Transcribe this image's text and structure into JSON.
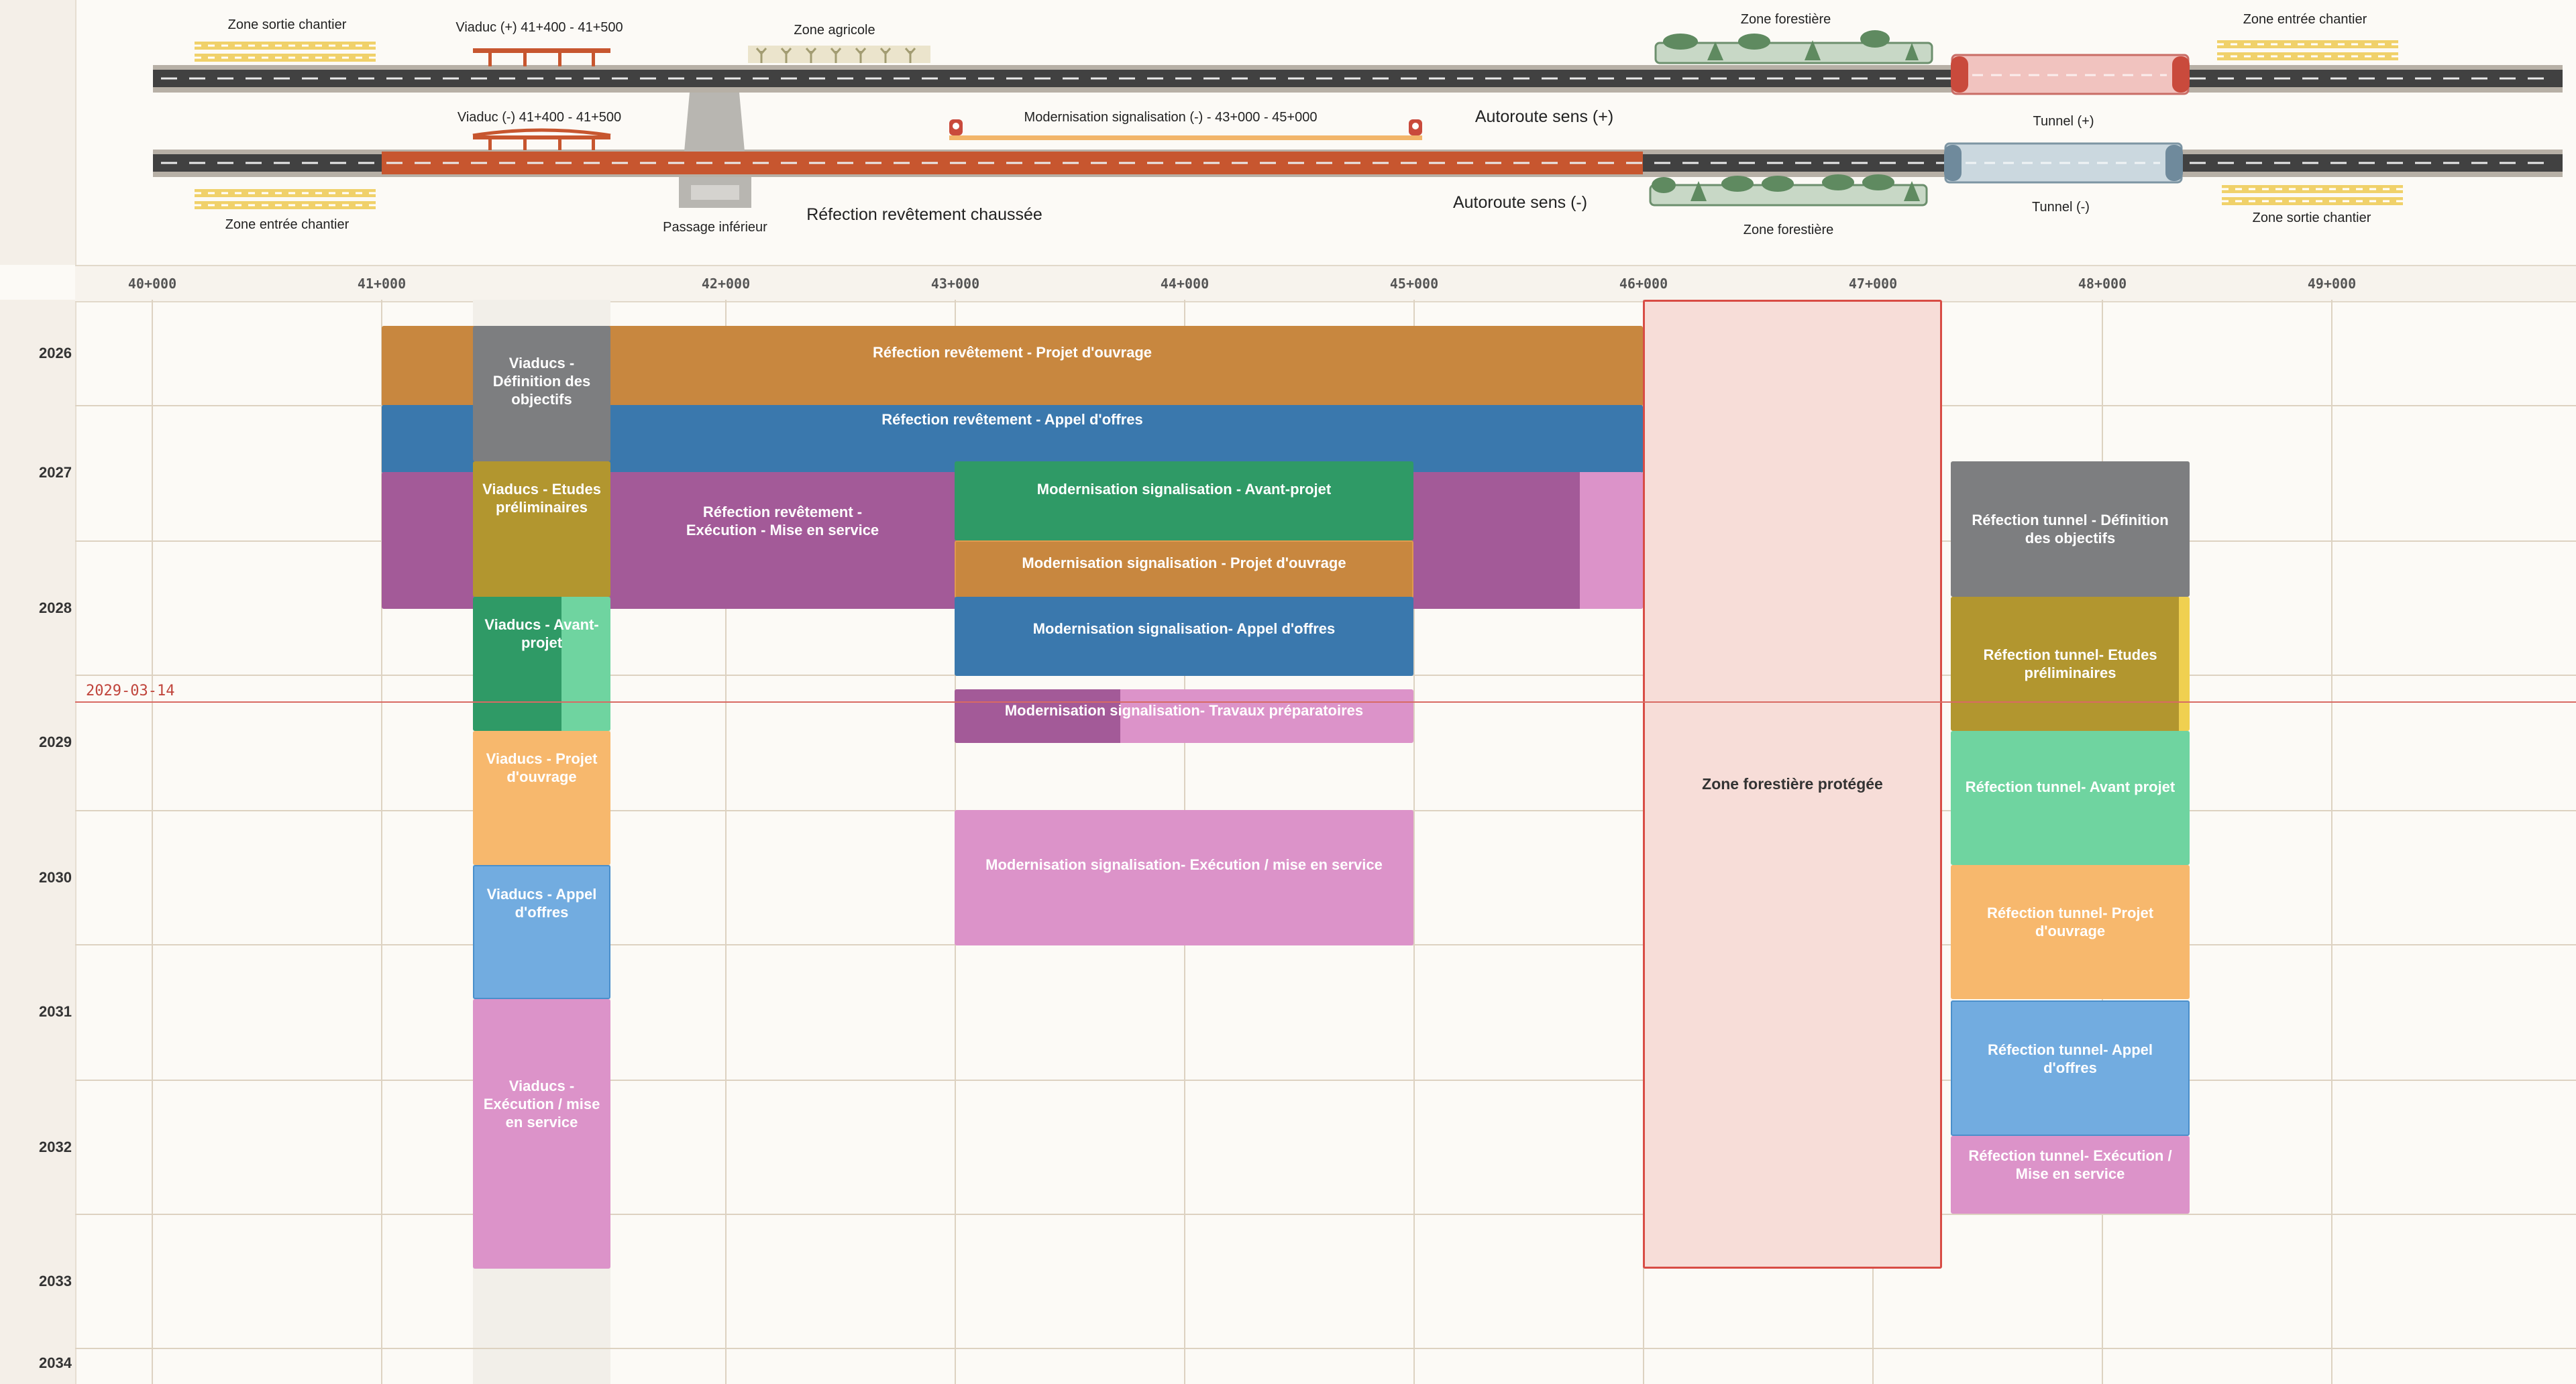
{
  "scene": {
    "zone_sortie_chantier_top": "Zone sortie chantier",
    "viaduc_plus": "Viaduc (+) 41+400 - 41+500",
    "zone_agricole": "Zone agricole",
    "zone_forestiere_top": "Zone forestière",
    "zone_entree_chantier_top": "Zone entrée chantier",
    "viaduc_minus": "Viaduc (-) 41+400 - 41+500",
    "modernisation_label": "Modernisation signalisation (-) - 43+000 - 45+000",
    "autoroute_plus": "Autoroute sens (+)",
    "tunnel_plus": "Tunnel (+)",
    "autoroute_minus": "Autoroute sens (-)",
    "tunnel_minus": "Tunnel (-)",
    "zone_entree_chantier_bottom": "Zone entrée chantier",
    "passage_inferieur": "Passage inférieur",
    "refection_chaussee": "Réfection revêtement chaussée",
    "zone_forestiere_bottom": "Zone forestière",
    "zone_sortie_chantier_bottom": "Zone sortie chantier"
  },
  "ruler": {
    "ticks": [
      "40+000",
      "41+000",
      "42+000",
      "43+000",
      "44+000",
      "45+000",
      "46+000",
      "47+000",
      "48+000",
      "49+000"
    ]
  },
  "years": [
    "2026",
    "2027",
    "2028",
    "2029",
    "2030",
    "2031",
    "2032",
    "2033",
    "2034"
  ],
  "today": "2029-03-14",
  "colors": {
    "orange": "#c8873f",
    "blue": "#3a78ad",
    "purple": "#a35a98",
    "pink": "#dc93c9",
    "gray": "#7d7e80",
    "olive": "#b2962f",
    "green": "#2f9a66",
    "light_green": "#6fd4a0",
    "light_orange": "#f7b86d",
    "light_blue": "#72ace0",
    "protected_fill": "#f7ddd8",
    "protected_border": "#d84c45"
  },
  "tasks": {
    "ref_projet": "Réfection revêtement - Projet d'ouvrage",
    "ref_appel": "Réfection revêtement - Appel d'offres",
    "ref_exec": "Réfection revêtement -\nExécution - Mise en service",
    "via_def": "Viaducs -\nDéfinition des\nobjectifs",
    "via_etudes": "Viaducs - Etudes\npréliminaires",
    "via_avant": "Viaducs - Avant-\nprojet",
    "via_projet": "Viaducs - Projet\nd'ouvrage",
    "via_appel": "Viaducs - Appel\nd'offres",
    "via_exec": "Viaducs -\nExécution / mise\nen service",
    "mod_avant": "Modernisation signalisation - Avant-projet",
    "mod_projet": "Modernisation signalisation - Projet d'ouvrage",
    "mod_appel": "Modernisation signalisation- Appel d'offres",
    "mod_travaux": "Modernisation signalisation- Travaux préparatoires",
    "mod_exec": "Modernisation signalisation- Exécution / mise en service",
    "zone_protegee": "Zone forestière protégée",
    "tun_def": "Réfection tunnel - Définition\ndes objectifs",
    "tun_etudes": "Réfection tunnel- Etudes\npréliminaires",
    "tun_avant": "Réfection tunnel- Avant projet",
    "tun_projet": "Réfection tunnel- Projet\nd'ouvrage",
    "tun_appel": "Réfection tunnel- Appel\nd'offres",
    "tun_exec": "Réfection tunnel- Exécution /\nMise en service"
  }
}
